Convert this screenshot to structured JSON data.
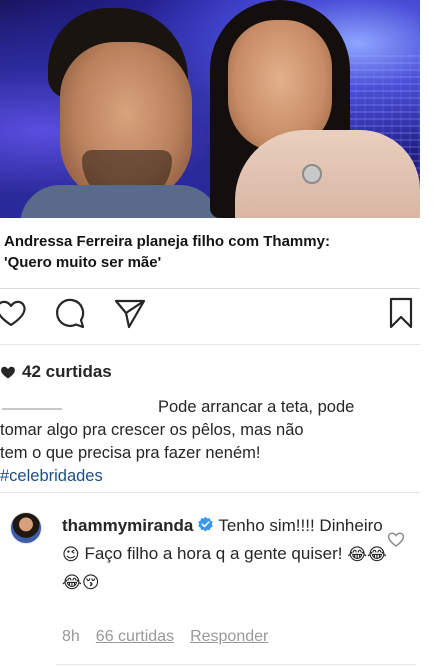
{
  "post": {
    "headline_line1": "Andressa Ferreira planeja filho com Thammy:",
    "headline_line2": "'Quero muito ser mãe'",
    "likes_count": "42 curtidas",
    "caption": {
      "line1": "Pode arrancar a teta, pode",
      "line2": "tomar algo pra crescer os pêlos, mas não",
      "line3": "tem o que precisa pra fazer neném!",
      "hashtag": "#celebridades"
    }
  },
  "icons": {
    "like": "heart-outline-icon",
    "comment": "comment-bubble-icon",
    "share": "paper-plane-icon",
    "save": "bookmark-icon",
    "likes_heart": "heart-filled-icon",
    "verified": "verified-badge-icon",
    "comment_like": "heart-outline-icon"
  },
  "comment": {
    "username": "thammymiranda",
    "text_part1": "Tenho sim!!!! Dinheiro",
    "emoji1": "😉",
    "text_part2": " Faço filho a hora q a gente quiser! ",
    "emoji2": "😂😂",
    "emoji3": "😂😚",
    "time": "8h",
    "likes": "66 curtidas",
    "reply": "Responder"
  },
  "colors": {
    "text": "#262626",
    "hashtag": "#1d4f85",
    "verified": "#3897f0",
    "meta": "#999999"
  }
}
